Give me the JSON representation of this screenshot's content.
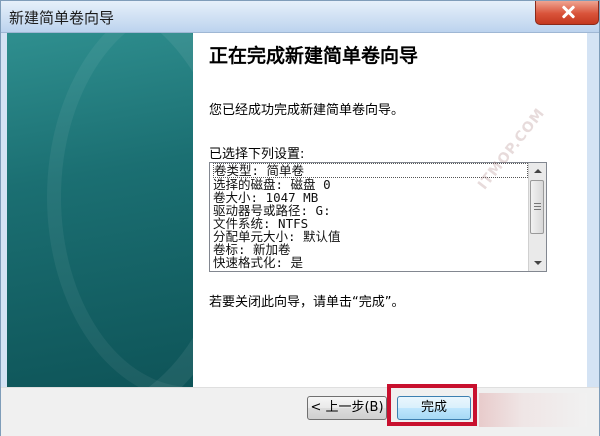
{
  "window": {
    "title": "新建简单卷向导"
  },
  "content": {
    "heading": "正在完成新建简单卷向导",
    "success_text": "您已经成功完成新建简单卷向导。",
    "settings_label": "已选择下列设置:",
    "settings_lines": [
      "卷类型: 简单卷",
      "选择的磁盘: 磁盘 0",
      "卷大小: 1047 MB",
      "驱动器号或路径: G:",
      "文件系统: NTFS",
      "分配单元大小: 默认值",
      "卷标: 新加卷",
      "快速格式化: 是"
    ],
    "close_hint": "若要关闭此向导，请单击“完成”。"
  },
  "buttons": {
    "back_label": "< 上一步(B)",
    "finish_label": "完成"
  },
  "watermark_text": "ITMOP.COM",
  "colors": {
    "highlight": "#c8102e",
    "side_panel": "#1b6f72"
  }
}
